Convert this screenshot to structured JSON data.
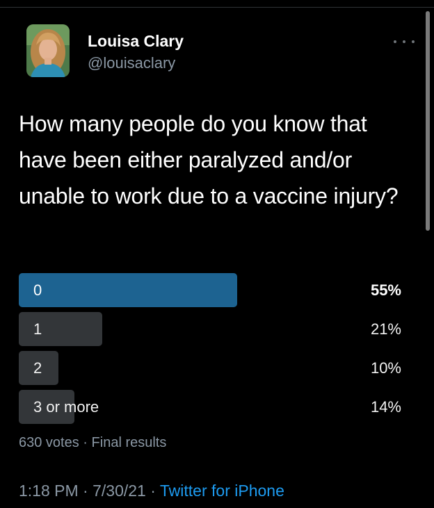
{
  "author": {
    "display_name": "Louisa Clary",
    "handle": "@louisaclary"
  },
  "tweet": {
    "text": "How many people do you know that have been either paralyzed and/or unable to work due to a vaccine injury?"
  },
  "poll": {
    "options": [
      {
        "label": "0",
        "percent_text": "55%",
        "percent": 55,
        "winner": true
      },
      {
        "label": "1",
        "percent_text": "21%",
        "percent": 21,
        "winner": false
      },
      {
        "label": "2",
        "percent_text": "10%",
        "percent": 10,
        "winner": false
      },
      {
        "label": "3 or more",
        "percent_text": "14%",
        "percent": 14,
        "winner": false
      }
    ],
    "votes": "630 votes",
    "separator": "·",
    "status": "Final results"
  },
  "meta": {
    "time": "1:18 PM",
    "separator": "·",
    "date": "7/30/21",
    "source": "Twitter for iPhone"
  },
  "colors": {
    "background": "#000000",
    "winner_bar": "#1d6391",
    "bar": "#333639",
    "link": "#1d9bf0",
    "secondary_text": "#8b98a5"
  },
  "icons": {
    "more": "more-horizontal-icon"
  }
}
